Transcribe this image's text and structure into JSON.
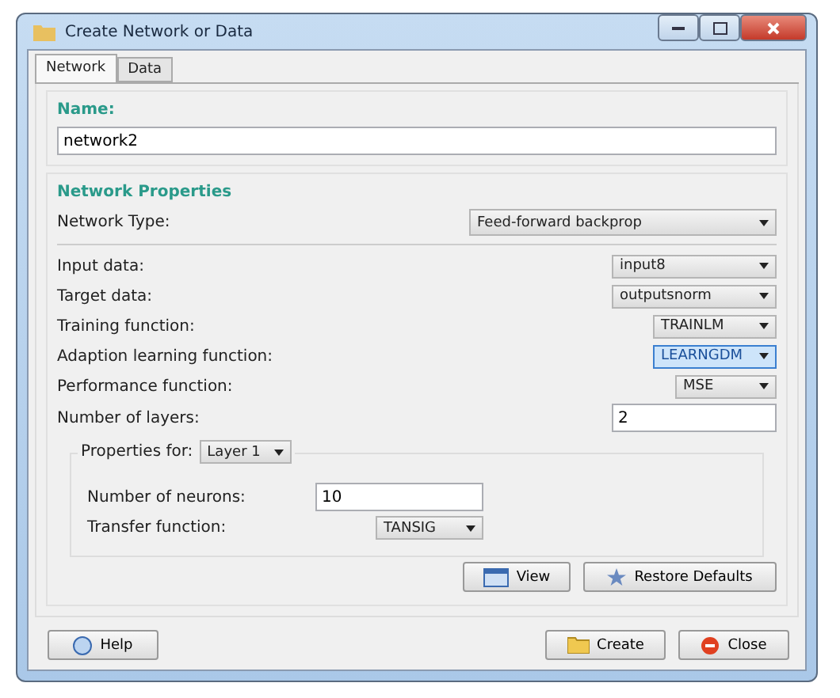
{
  "window": {
    "title": "Create Network or Data"
  },
  "tabs": [
    {
      "label": "Network",
      "selected": true
    },
    {
      "label": "Data",
      "selected": false
    }
  ],
  "name": {
    "heading": "Name:",
    "value": "network2"
  },
  "network_properties": {
    "heading": "Network Properties",
    "network_type": {
      "label": "Network Type:",
      "value": "Feed-forward backprop"
    },
    "rows": [
      {
        "kind": "combo",
        "label": "Input data:",
        "value": "input8",
        "focused": false
      },
      {
        "kind": "combo",
        "label": "Target data:",
        "value": "outputsnorm",
        "focused": false
      },
      {
        "kind": "combo",
        "label": "Training function:",
        "value": "TRAINLM",
        "focused": false
      },
      {
        "kind": "combo",
        "label": "Adaption learning function:",
        "value": "LEARNGDM",
        "focused": true
      },
      {
        "kind": "combo",
        "label": "Performance function:",
        "value": "MSE",
        "focused": false
      },
      {
        "kind": "field",
        "label": "Number of layers:",
        "value": "2"
      }
    ]
  },
  "layer_properties": {
    "label": "Properties for:",
    "layer": "Layer 1",
    "rows": [
      {
        "kind": "field",
        "label": "Number of neurons:",
        "value": "10"
      },
      {
        "kind": "combo",
        "label": "Transfer function:",
        "value": "TANSIG",
        "focused": false
      }
    ]
  },
  "panel_buttons": [
    {
      "kind": "view",
      "label": "View"
    },
    {
      "kind": "restore",
      "label": "Restore Defaults"
    }
  ],
  "footer_buttons": [
    {
      "kind": "help",
      "label": "Help"
    },
    {
      "kind": "create",
      "label": "Create"
    },
    {
      "kind": "close",
      "label": "Close"
    }
  ]
}
